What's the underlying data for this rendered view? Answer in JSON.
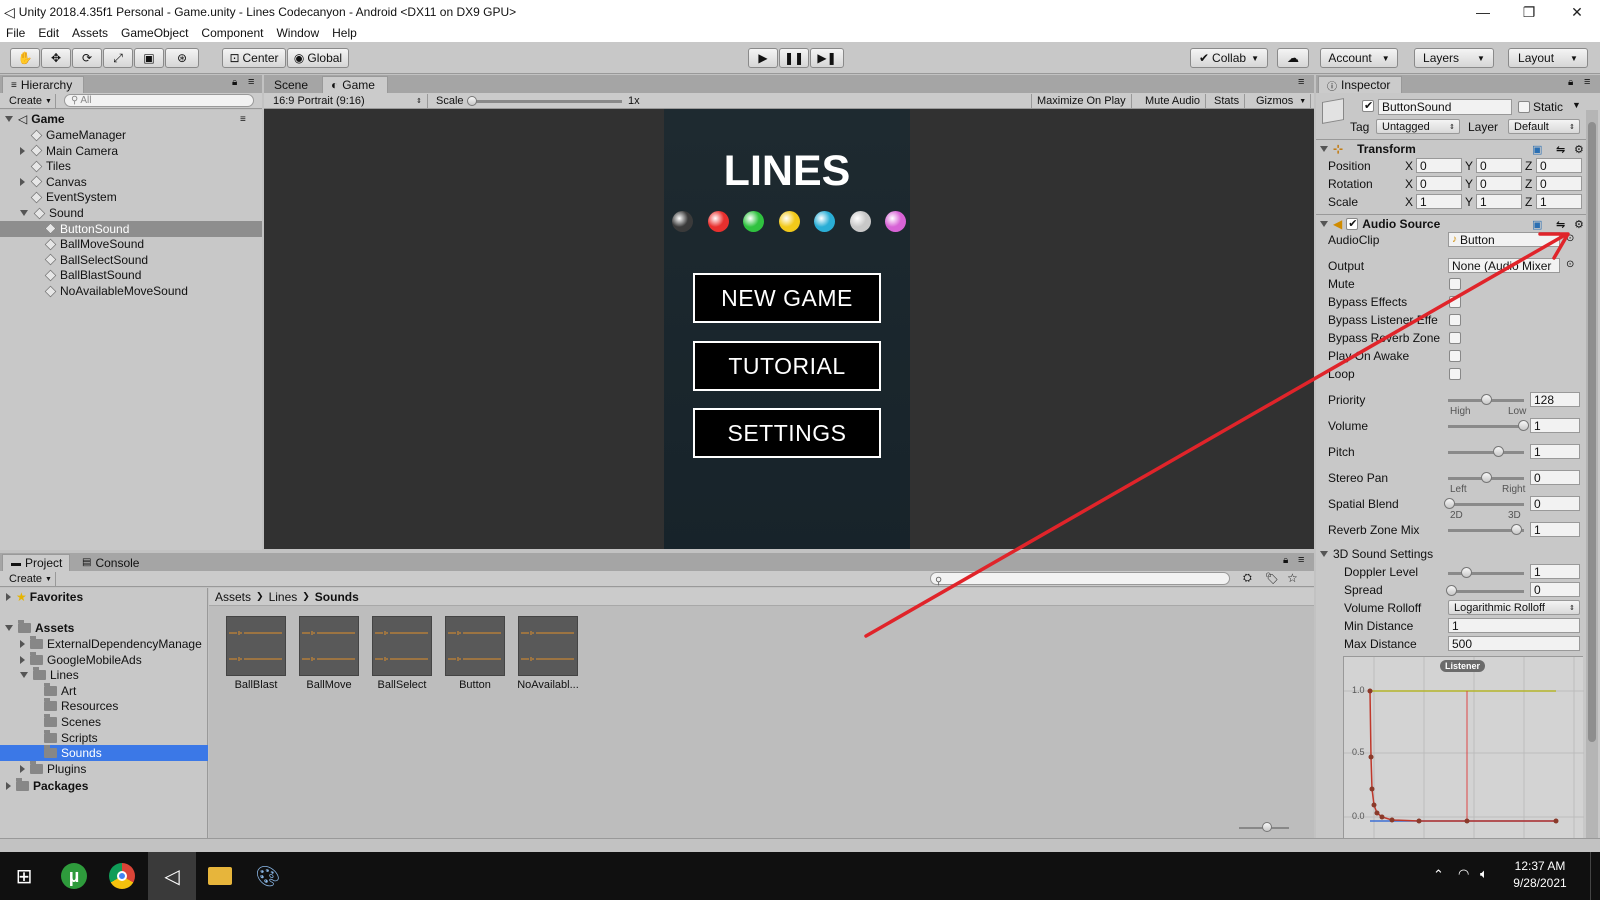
{
  "window": {
    "title": "Unity 2018.4.35f1 Personal - Game.unity - Lines Codecanyon - Android <DX11 on DX9 GPU>"
  },
  "menu": [
    "File",
    "Edit",
    "Assets",
    "GameObject",
    "Component",
    "Window",
    "Help"
  ],
  "toolbar": {
    "pivot": "Center",
    "space": "Global",
    "collab": "Collab",
    "account": "Account",
    "layers": "Layers",
    "layout": "Layout"
  },
  "hierarchy": {
    "tab": "Hierarchy",
    "create": "Create",
    "search_placeholder": "All",
    "scene": "Game",
    "items": [
      {
        "label": "GameManager",
        "indent": 1,
        "expand": ""
      },
      {
        "label": "Main Camera",
        "indent": 1,
        "expand": "right"
      },
      {
        "label": "Tiles",
        "indent": 1,
        "expand": ""
      },
      {
        "label": "Canvas",
        "indent": 1,
        "expand": "right"
      },
      {
        "label": "EventSystem",
        "indent": 1,
        "expand": ""
      },
      {
        "label": "Sound",
        "indent": 1,
        "expand": "down"
      },
      {
        "label": "ButtonSound",
        "indent": 2,
        "expand": "",
        "selected": true
      },
      {
        "label": "BallMoveSound",
        "indent": 2,
        "expand": ""
      },
      {
        "label": "BallSelectSound",
        "indent": 2,
        "expand": ""
      },
      {
        "label": "BallBlastSound",
        "indent": 2,
        "expand": ""
      },
      {
        "label": "NoAvailableMoveSound",
        "indent": 2,
        "expand": ""
      }
    ]
  },
  "game_view": {
    "tabs": [
      "Scene",
      "Game"
    ],
    "aspect": "16:9 Portrait (9:16)",
    "scale_label": "Scale",
    "scale_value": "1x",
    "options": [
      "Maximize On Play",
      "Mute Audio",
      "Stats",
      "Gizmos"
    ],
    "game_title": "LINES",
    "buttons": [
      "NEW GAME",
      "TUTORIAL",
      "SETTINGS"
    ],
    "ball_colors": [
      "#3a3a3a",
      "#e8302e",
      "#2fc23f",
      "#f2c91a",
      "#2aaed6",
      "#c8c8c8",
      "#d763d6"
    ]
  },
  "project": {
    "tabs": [
      "Project",
      "Console"
    ],
    "create": "Create",
    "favorites": "Favorites",
    "assets": "Assets",
    "tree": [
      {
        "label": "ExternalDependencyManage",
        "indent": 1,
        "expand": "right"
      },
      {
        "label": "GoogleMobileAds",
        "indent": 1,
        "expand": "right"
      },
      {
        "label": "Lines",
        "indent": 1,
        "expand": "down"
      },
      {
        "label": "Art",
        "indent": 2,
        "expand": ""
      },
      {
        "label": "Resources",
        "indent": 2,
        "expand": ""
      },
      {
        "label": "Scenes",
        "indent": 2,
        "expand": ""
      },
      {
        "label": "Scripts",
        "indent": 2,
        "expand": ""
      },
      {
        "label": "Sounds",
        "indent": 2,
        "expand": "",
        "selected": true
      },
      {
        "label": "Plugins",
        "indent": 1,
        "expand": "right"
      }
    ],
    "packages": "Packages",
    "breadcrumb": [
      "Assets",
      "Lines",
      "Sounds"
    ],
    "files": [
      "BallBlast",
      "BallMove",
      "BallSelect",
      "Button",
      "NoAvailabl..."
    ]
  },
  "inspector": {
    "tab": "Inspector",
    "object_name": "ButtonSound",
    "static_label": "Static",
    "tag_label": "Tag",
    "tag_value": "Untagged",
    "layer_label": "Layer",
    "layer_value": "Default",
    "transform": {
      "title": "Transform",
      "rows": [
        {
          "label": "Position",
          "x": "0",
          "y": "0",
          "z": "0"
        },
        {
          "label": "Rotation",
          "x": "0",
          "y": "0",
          "z": "0"
        },
        {
          "label": "Scale",
          "x": "1",
          "y": "1",
          "z": "1"
        }
      ]
    },
    "audio_source": {
      "title": "Audio Source",
      "audioclip_label": "AudioClip",
      "audioclip_value": "Button",
      "output_label": "Output",
      "output_value": "None (Audio Mixer",
      "toggles": [
        "Mute",
        "Bypass Effects",
        "Bypass Listener Effe",
        "Bypass Reverb Zone",
        "Play On Awake",
        "Loop"
      ],
      "sliders": [
        {
          "label": "Priority",
          "value": "128",
          "left": "High",
          "right": "Low",
          "pos": 0.5
        },
        {
          "label": "Volume",
          "value": "1",
          "left": "",
          "right": "",
          "pos": 1
        },
        {
          "label": "Pitch",
          "value": "1",
          "left": "",
          "right": "",
          "pos": 0.66
        },
        {
          "label": "Stereo Pan",
          "value": "0",
          "left": "Left",
          "right": "Right",
          "pos": 0.5
        },
        {
          "label": "Spatial Blend",
          "value": "0",
          "left": "2D",
          "right": "3D",
          "pos": 0
        },
        {
          "label": "Reverb Zone Mix",
          "value": "1",
          "left": "",
          "right": "",
          "pos": 0.9
        }
      ],
      "sound3d": {
        "title": "3D Sound Settings",
        "doppler_label": "Doppler Level",
        "doppler": "1",
        "spread_label": "Spread",
        "spread": "0",
        "rolloff_label": "Volume Rolloff",
        "rolloff": "Logarithmic Rolloff",
        "min_label": "Min Distance",
        "min": "1",
        "max_label": "Max Distance",
        "max": "500"
      },
      "graph": {
        "listener": "Listener",
        "y_labels": [
          "1.0",
          "0.5",
          "0.0"
        ]
      }
    }
  },
  "taskbar": {
    "time": "12:37 AM",
    "date": "9/28/2021"
  }
}
